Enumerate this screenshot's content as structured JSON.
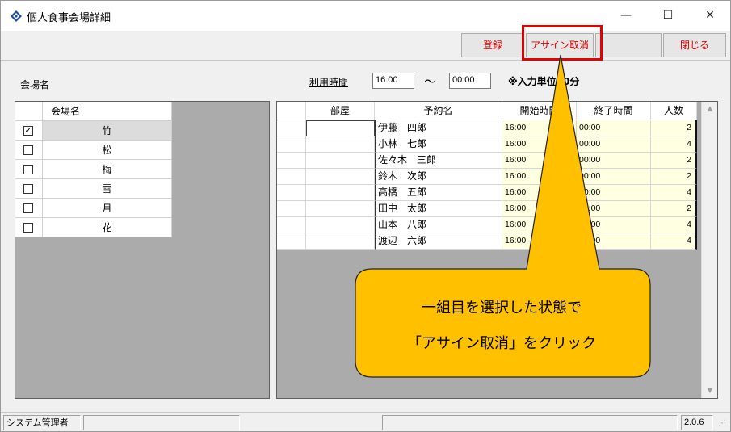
{
  "window": {
    "title": "個人食事会場詳細"
  },
  "title_controls": {
    "minimize": "—",
    "maximize": "☐",
    "close": "✕"
  },
  "toolbar": {
    "register": "登録",
    "unassign": "アサイン取消",
    "close": "閉じる"
  },
  "header": {
    "venue_label": "会場名",
    "time_label": "利用時間",
    "start_time": "16:00",
    "tilde": "～",
    "end_time": "00:00",
    "note": "※入力単位30分"
  },
  "venue_grid": {
    "header": "会場名",
    "rows": [
      {
        "checked": true,
        "name": "竹"
      },
      {
        "checked": false,
        "name": "松"
      },
      {
        "checked": false,
        "name": "梅"
      },
      {
        "checked": false,
        "name": "雪"
      },
      {
        "checked": false,
        "name": "月"
      },
      {
        "checked": false,
        "name": "花"
      }
    ]
  },
  "reservation_grid": {
    "headers": {
      "room": "部屋",
      "name": "予約名",
      "start": "開始時間",
      "end": "終了時間",
      "count": "人数"
    },
    "rows": [
      {
        "name": "伊藤　四郎",
        "start": "16:00",
        "end": "00:00",
        "count": "2"
      },
      {
        "name": "小林　七郎",
        "start": "16:00",
        "end": "00:00",
        "count": "4"
      },
      {
        "name": "佐々木　三郎",
        "start": "16:00",
        "end": "00:00",
        "count": "2"
      },
      {
        "name": "鈴木　次郎",
        "start": "16:00",
        "end": "00:00",
        "count": "2"
      },
      {
        "name": "高橋　五郎",
        "start": "16:00",
        "end": "00:00",
        "count": "4"
      },
      {
        "name": "田中　太郎",
        "start": "16:00",
        "end": "00:00",
        "count": "2"
      },
      {
        "name": "山本　八郎",
        "start": "16:00",
        "end": "00:00",
        "count": "4"
      },
      {
        "name": "渡辺　六郎",
        "start": "16:00",
        "end": "00:00",
        "count": "4"
      }
    ]
  },
  "callout": {
    "line1": "一組目を選択した状態で",
    "line2": "「アサイン取消」をクリック"
  },
  "statusbar": {
    "user": "システム管理者",
    "version": "2.0.6"
  },
  "colors": {
    "accent_red": "#e60000",
    "callout_fill": "#ffc000",
    "cell_yellow": "#ffffe1"
  }
}
